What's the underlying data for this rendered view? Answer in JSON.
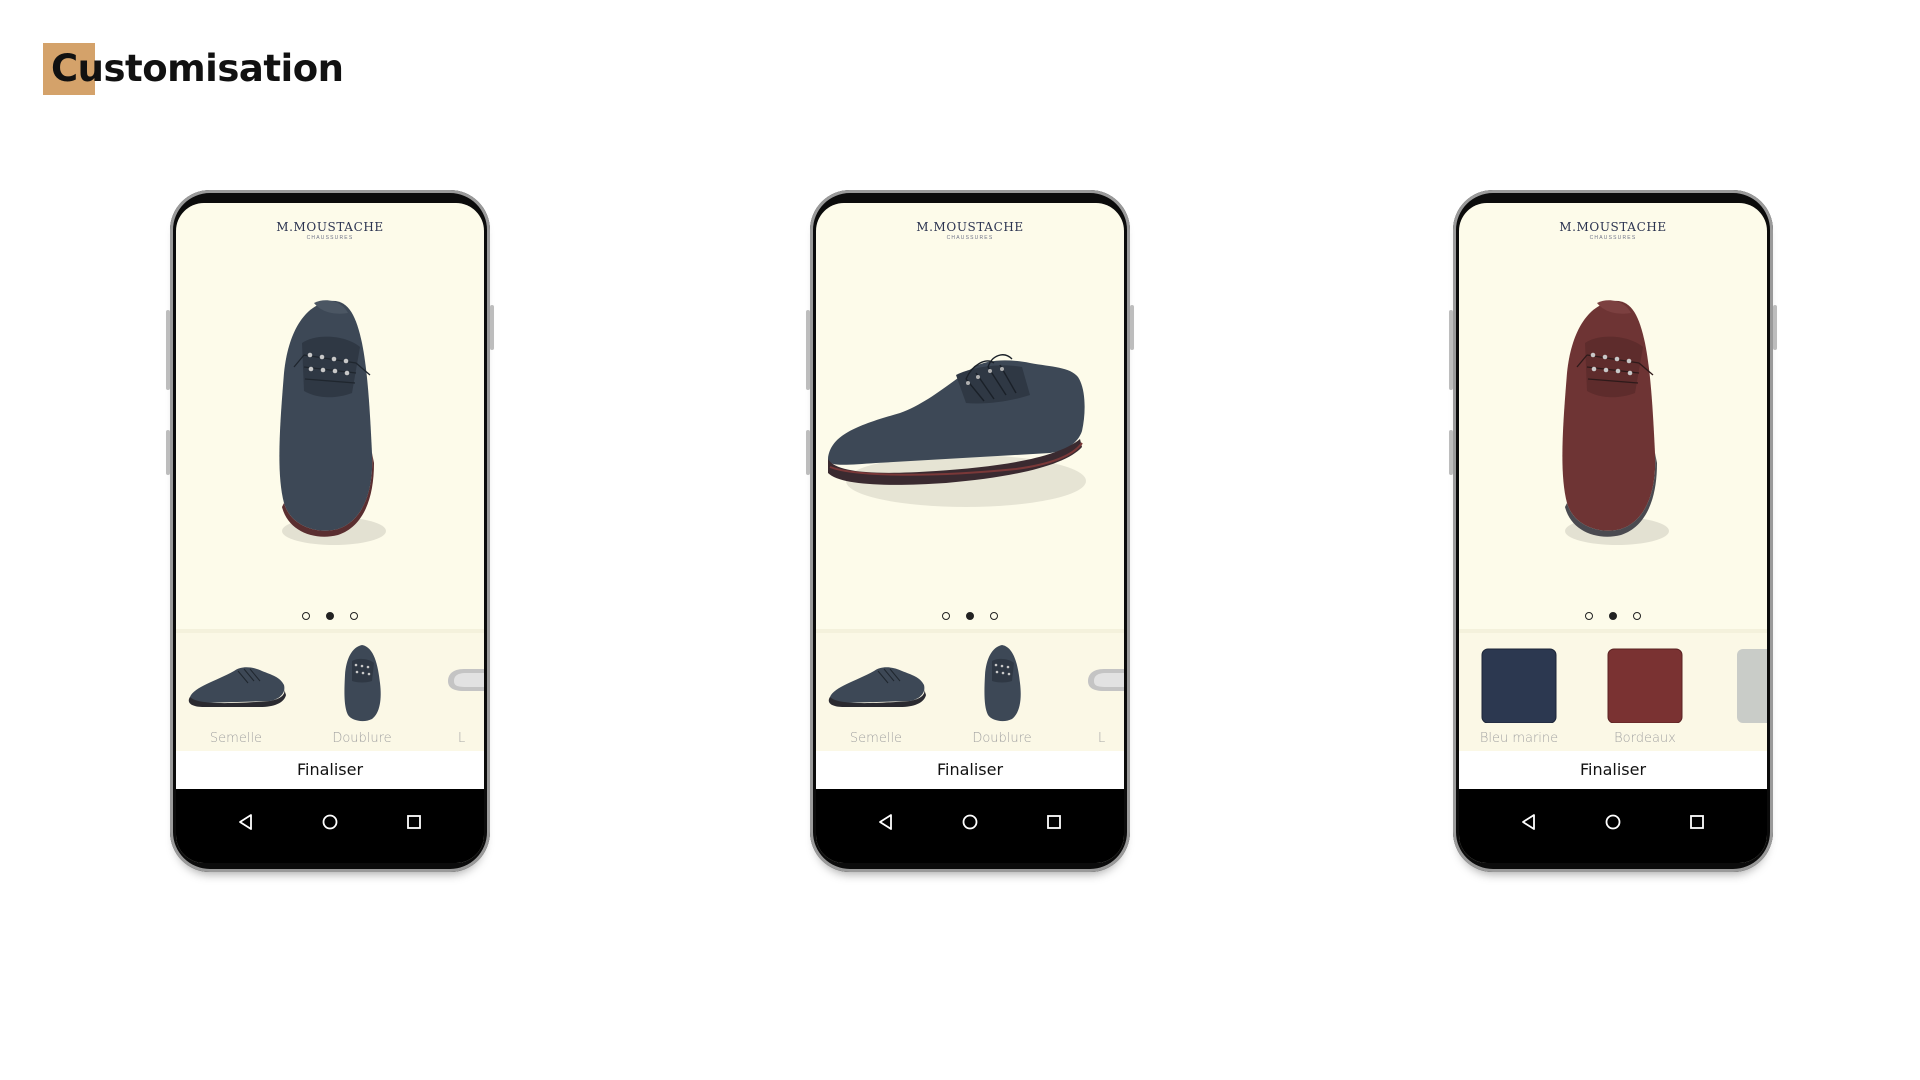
{
  "page": {
    "title": "Customisation",
    "accent_color": "#d4a26a"
  },
  "phones": [
    {
      "brand": {
        "name": "M.MOUSTACHE",
        "sub": "CHAUSSURES"
      },
      "hero": "shoe-top-view-navy",
      "carousel": {
        "count": 3,
        "active": 1
      },
      "options": [
        {
          "label": "Semelle",
          "icon": "shoe-side-icon"
        },
        {
          "label": "Doublure",
          "icon": "shoe-top-icon"
        },
        {
          "label": "L",
          "icon": "shoe-partial-icon"
        }
      ],
      "finalize_label": "Finaliser",
      "nav": [
        "back-icon",
        "home-icon",
        "recents-icon"
      ]
    },
    {
      "brand": {
        "name": "M.MOUSTACHE",
        "sub": "CHAUSSURES"
      },
      "hero": "shoe-side-view-navy",
      "carousel": {
        "count": 3,
        "active": 1
      },
      "options": [
        {
          "label": "Semelle",
          "icon": "shoe-side-icon"
        },
        {
          "label": "Doublure",
          "icon": "shoe-top-icon"
        },
        {
          "label": "L",
          "icon": "shoe-partial-icon"
        }
      ],
      "finalize_label": "Finaliser",
      "nav": [
        "back-icon",
        "home-icon",
        "recents-icon"
      ]
    },
    {
      "brand": {
        "name": "M.MOUSTACHE",
        "sub": "CHAUSSURES"
      },
      "hero": "shoe-top-view-bordeaux",
      "carousel": {
        "count": 3,
        "active": 1
      },
      "options": [
        {
          "label": "Bleu marine",
          "icon": "leather-swatch-navy",
          "color": "#2c3850"
        },
        {
          "label": "Bordeaux",
          "icon": "leather-swatch-bordeaux",
          "color": "#7a3232"
        },
        {
          "label": "",
          "icon": "leather-swatch-grey",
          "color": "#c9ccc8"
        }
      ],
      "finalize_label": "Finaliser",
      "nav": [
        "back-icon",
        "home-icon",
        "recents-icon"
      ]
    }
  ],
  "colors": {
    "screen_bg": "#fdfbea",
    "shoe_navy": "#3d4856",
    "shoe_bordeaux": "#6e3434",
    "sole": "#4a2a2a"
  }
}
